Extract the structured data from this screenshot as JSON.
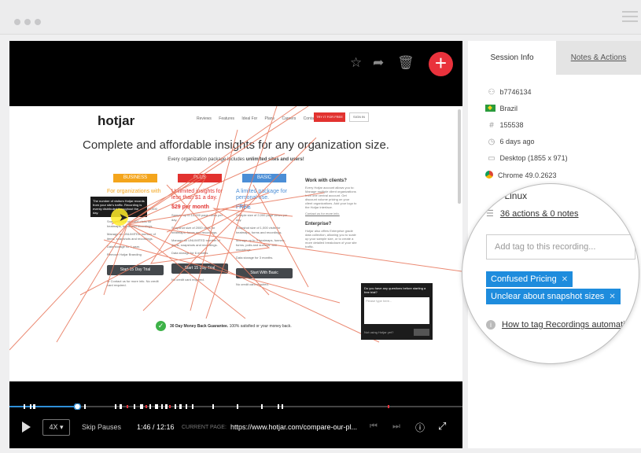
{
  "session": {
    "tabs": [
      "Session Info",
      "Notes & Actions"
    ],
    "user_id": "b7746134",
    "country": "Brazil",
    "session_number": "155538",
    "time_ago": "6 days ago",
    "device": "Desktop (1855 x 971)",
    "browser": "Chrome 49.0.2623",
    "os": "Linux",
    "actions": "36 actions & 0 notes",
    "tag_placeholder": "Add tag to this recording...",
    "tags": [
      "Confused Pricing",
      "Unclear about snapshot sizes"
    ],
    "help_link": "How to tag Recordings automatic"
  },
  "player": {
    "speed": "4X",
    "skip_label": "Skip Pauses",
    "time": "1:46 / 12:16",
    "current_page_label": "CURRENT PAGE:",
    "current_page_url": "https://www.hotjar.com/compare-our-pl...",
    "progress": 0.15
  },
  "website": {
    "logo": "hotjar",
    "nav": [
      "Reviews",
      "Features",
      "Ideal For",
      "Plans",
      "Careers",
      "Contact"
    ],
    "free_btn": "TRY IT FOR FREE",
    "signin_btn": "SIGN IN",
    "headline": "Complete and affordable insights for any organization size.",
    "subline_a": "Every organization package includes ",
    "subline_b": "unlimited sites and users!",
    "tooltip": "The number of visitors Hotjar records from your site's traffic. Recording is evenly distributed throughout the day.",
    "plans": [
      {
        "tag": "BUSINESS",
        "title": "For organizations with",
        "price": "from",
        "line1": "Sample visitors starting from 20,000 page views per day.",
        "line2": "Snapshot size of 5,000 visits for heatmaps, forms and recordings.",
        "line3": "Manage an UNLIMITED number of items, snapshots and recordings.",
        "line4": "Data storage for 1 year.",
        "line5": "Remove Hotjar Branding",
        "btn": "Start 15 Day Trial",
        "nc": "or Contact us for more info. No credit card required."
      },
      {
        "tag": "PLUS",
        "title": "Unlimited insights for less than $1 a day.",
        "price": "$29 per month",
        "line1": "Sample up to 10,000 page views per day.",
        "line2": "Snapshot size of 2000 visits for heatmaps, forms and recordings.",
        "line3": "Manage an UNLIMITED number of items, snapshots and recordings.",
        "line4": "Data storage for 6 months.",
        "line5": "",
        "btn": "Start 15 Day Trial",
        "nc": "No credit card required."
      },
      {
        "tag": "BASIC",
        "title": "A limited package for personal use.",
        "price": "FREE",
        "line1": "Sample size of 2,000 page views per day.",
        "line2": "Snapshot size of 1,000 visits for heatmaps, forms and recordings.",
        "line3": "Manage up to 3 heatmaps, funnels, forms, polls and surveys. 300 recordings.",
        "line4": "Data storage for 3 months.",
        "line5": "",
        "btn": "Start With Basic",
        "nc": "No credit card required."
      }
    ],
    "clients_head": "Work with clients?",
    "clients_text": "Every Hotjar account allows you to: Manage multiple client organizations from one central account. Get discount volume pricing on your client organizations. Add your logo to the Hotjar interface.",
    "clients_link": "Contact us for more info.",
    "enterprise_head": "Enterprise?",
    "enterprise_text": "Hotjar also offers Enterprise grade data collection, allowing you to scale up your sample size, or to create a more detailed breakdown of your site traffic.",
    "guarantee_a": "30 Day Money Back Guarantee.",
    "guarantee_b": " 100% satisfied or your money back.",
    "chat_q": "Do you have any questions before starting a free trial?",
    "chat_ph": "Please type here...",
    "chat_nt": "Not using Hotjar yet?"
  },
  "colors": {
    "accent": "#e9323c",
    "tag_blue": "#1e8cdd",
    "business": "#f4a51c",
    "plus": "#e2322f",
    "basic": "#4b8ed6"
  },
  "icons": [
    "user-icon",
    "flag-icon",
    "hash-icon",
    "clock-icon",
    "desktop-icon",
    "chrome-icon",
    "linux-icon",
    "list-icon",
    "info-icon",
    "star-icon",
    "share-icon",
    "trash-icon",
    "plus-icon",
    "play-icon",
    "prev-icon",
    "next-icon",
    "fullscreen-icon"
  ]
}
